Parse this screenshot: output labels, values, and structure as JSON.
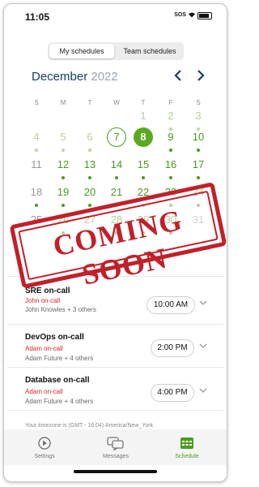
{
  "status": {
    "time": "11:05",
    "carrier": "SOS",
    "wifi": "wifi-icon",
    "battery": "battery-icon"
  },
  "segment": {
    "options": [
      "My schedules",
      "Team schedules"
    ],
    "selected": "My schedules"
  },
  "calendar": {
    "month": "December",
    "year": "2022",
    "weekdays": [
      "S",
      "M",
      "T",
      "W",
      "T",
      "F",
      "S"
    ],
    "today": "7",
    "selected": "8",
    "weeks": [
      [
        "",
        "",
        "",
        "",
        "1",
        "2",
        "3"
      ],
      [
        "4",
        "5",
        "6",
        "7",
        "8",
        "9",
        "10"
      ],
      [
        "11",
        "12",
        "13",
        "14",
        "15",
        "16",
        "17"
      ],
      [
        "18",
        "19",
        "20",
        "21",
        "22",
        "23",
        "24"
      ],
      [
        "25",
        "26",
        "27",
        "28",
        "29",
        "30",
        "31"
      ]
    ]
  },
  "stamp_text": "COMING SOON",
  "schedules": [
    {
      "title": "SRE on-call",
      "oncall": "John on-call",
      "people": "John Knowles + 3 others",
      "time": "10:00 AM"
    },
    {
      "title": "DevOps on-call",
      "oncall": "Adam on-call",
      "people": "Adam Future + 4 others",
      "time": "2:00 PM"
    },
    {
      "title": "Database on-call",
      "oncall": "Adam on-call",
      "people": "Adam Future + 4 others",
      "time": "4:00 PM"
    }
  ],
  "timezone": "Your timezone is (GMT - 16:04) America/New_York",
  "tabs": [
    {
      "label": "Settings",
      "icon": "settings-icon"
    },
    {
      "label": "Messages",
      "icon": "messages-icon"
    },
    {
      "label": "Schedule",
      "icon": "schedule-icon",
      "active": true
    }
  ],
  "colors": {
    "accent": "#4a9c1e",
    "navy": "#163c6f",
    "stamp": "#c1202a",
    "alert": "#dd2222"
  }
}
